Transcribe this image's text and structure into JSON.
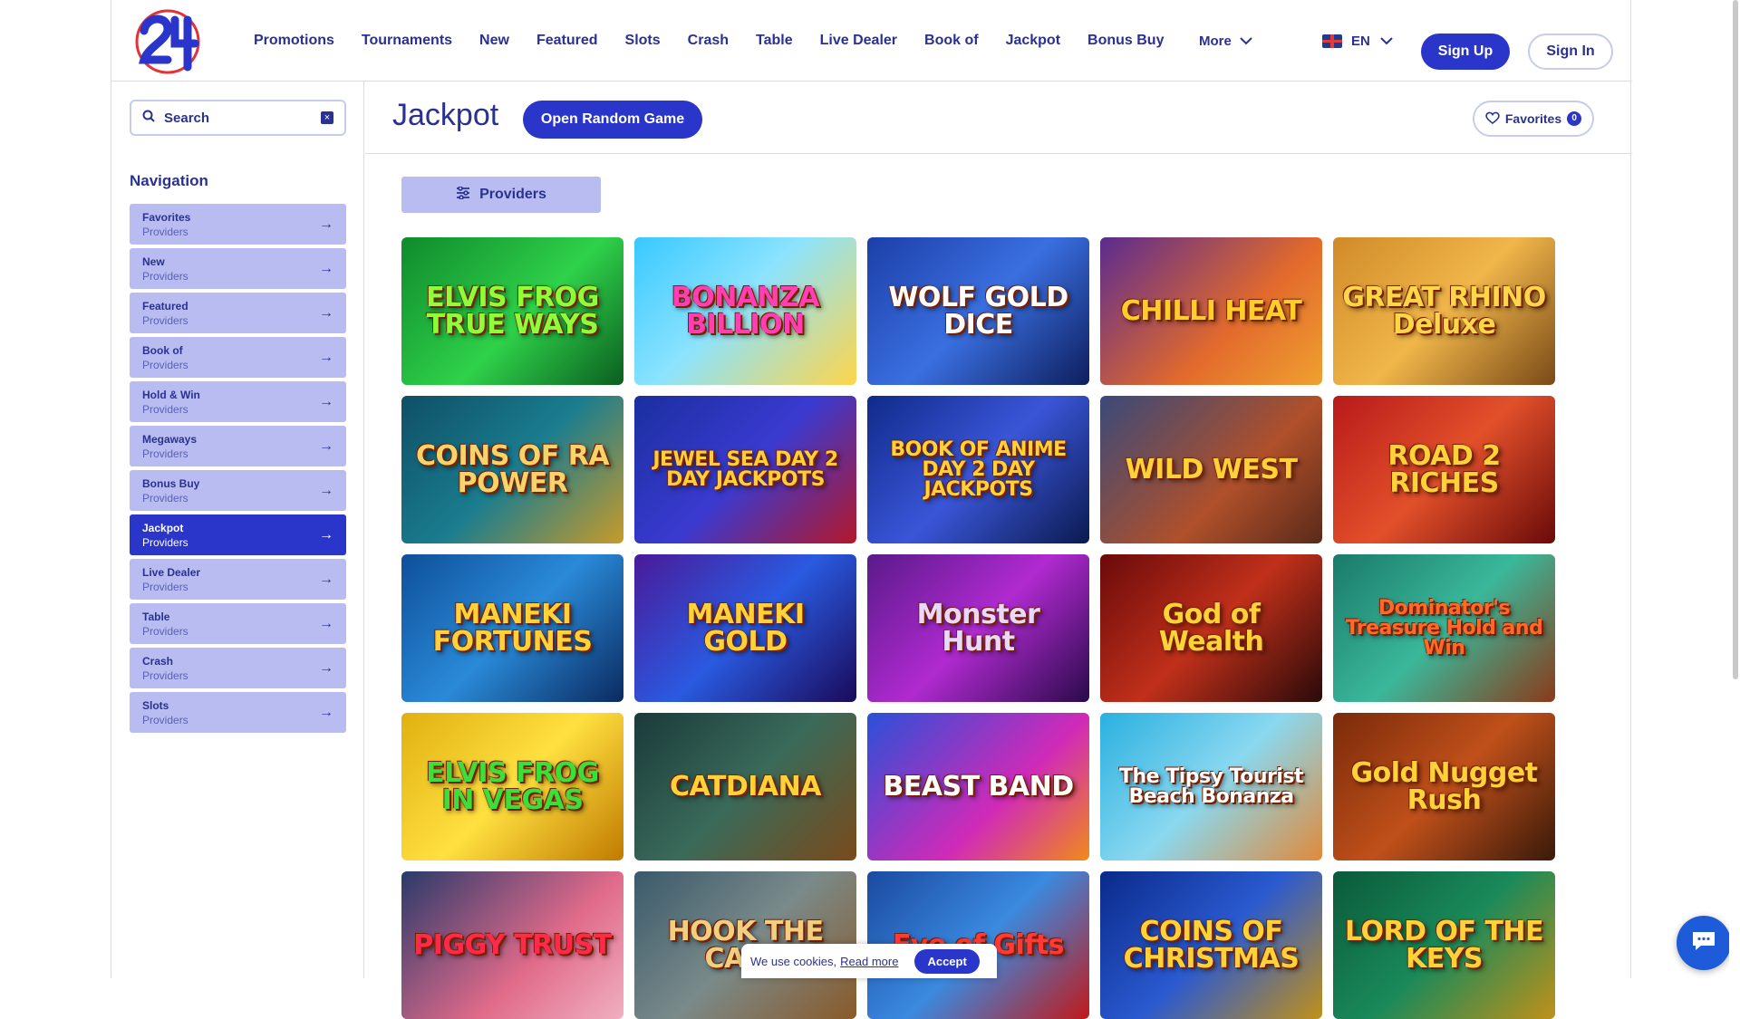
{
  "brand": {
    "logo_text": "24"
  },
  "nav": {
    "items": [
      "Promotions",
      "Tournaments",
      "New",
      "Featured",
      "Slots",
      "Crash",
      "Table",
      "Live Dealer",
      "Book of",
      "Jackpot",
      "Bonus Buy"
    ],
    "more_label": "More",
    "lang_label": "EN",
    "signup_label": "Sign Up",
    "signin_label": "Sign In"
  },
  "search": {
    "placeholder": "Search"
  },
  "sidebar": {
    "title": "Navigation",
    "items": [
      {
        "label": "Favorites",
        "sub": "Providers",
        "active": false
      },
      {
        "label": "New",
        "sub": "Providers",
        "active": false
      },
      {
        "label": "Featured",
        "sub": "Providers",
        "active": false
      },
      {
        "label": "Book of",
        "sub": "Providers",
        "active": false
      },
      {
        "label": "Hold & Win",
        "sub": "Providers",
        "active": false
      },
      {
        "label": "Megaways",
        "sub": "Providers",
        "active": false
      },
      {
        "label": "Bonus Buy",
        "sub": "Providers",
        "active": false
      },
      {
        "label": "Jackpot",
        "sub": "Providers",
        "active": true
      },
      {
        "label": "Live Dealer",
        "sub": "Providers",
        "active": false
      },
      {
        "label": "Table",
        "sub": "Providers",
        "active": false
      },
      {
        "label": "Crash",
        "sub": "Providers",
        "active": false
      },
      {
        "label": "Slots",
        "sub": "Providers",
        "active": false
      }
    ]
  },
  "main": {
    "title": "Jackpot",
    "random_label": "Open Random Game",
    "favorites_label": "Favorites",
    "favorites_count": "0",
    "providers_label": "Providers"
  },
  "games": [
    {
      "name": "ELVIS FROG TRUE WAYS",
      "bg": "linear-gradient(135deg,#0f8a2c,#2fd14a 55%,#0b5e20)",
      "color": "#8dff3a"
    },
    {
      "name": "BONANZA BILLION",
      "bg": "linear-gradient(135deg,#38c8ff,#8be3ff 45%,#ffd54a)",
      "color": "#ff3fb2"
    },
    {
      "name": "WOLF GOLD DICE",
      "bg": "linear-gradient(135deg,#1c3fa8,#3a6fe0 50%,#0e1f5e)",
      "color": "#ffffff"
    },
    {
      "name": "CHILLI HEAT",
      "bg": "linear-gradient(135deg,#5b2b8f,#e26a2c 60%,#f0a030)",
      "color": "#ffce2a"
    },
    {
      "name": "GREAT RHINO Deluxe",
      "bg": "linear-gradient(135deg,#d08a28,#f0b64a 50%,#7a4a18)",
      "color": "#ffd54a"
    },
    {
      "name": "COINS OF RA POWER",
      "bg": "linear-gradient(135deg,#0f4f66,#1a7d8f 50%,#c79a2a)",
      "color": "#f7d46a"
    },
    {
      "name": "JEWEL SEA DAY 2 DAY JACKPOTS",
      "bg": "linear-gradient(135deg,#1a2fa0,#3a3ad0 50%,#b3172a)",
      "color": "#ffcf3a"
    },
    {
      "name": "BOOK OF ANIME DAY 2 DAY JACKPOTS",
      "bg": "linear-gradient(135deg,#102a8a,#3a56d8 50%,#0b1a50)",
      "color": "#ffd23a"
    },
    {
      "name": "WILD WEST",
      "bg": "linear-gradient(135deg,#3a4a7a,#b0502a 60%,#5a2a1a)",
      "color": "#ffd23a"
    },
    {
      "name": "ROAD 2 RICHES",
      "bg": "linear-gradient(135deg,#b81a1a,#e2502a 50%,#6a0a0a)",
      "color": "#ffd23a"
    },
    {
      "name": "MANEKI FORTUNES",
      "bg": "linear-gradient(135deg,#0e4f9a,#2a8ad8 50%,#0a2a60)",
      "color": "#ffd23a"
    },
    {
      "name": "MANEKI GOLD",
      "bg": "linear-gradient(135deg,#4a1a9a,#2a5ae0 50%,#1a0a5a)",
      "color": "#ffd23a"
    },
    {
      "name": "Monster Hunt",
      "bg": "linear-gradient(135deg,#5a1a8a,#b02ad0 50%,#2a0a4a)",
      "color": "#e8d8ff"
    },
    {
      "name": "God of Wealth",
      "bg": "linear-gradient(135deg,#6a0a0a,#c0301a 50%,#2a0a0a)",
      "color": "#ffd23a"
    },
    {
      "name": "Dominator's Treasure Hold and Win",
      "bg": "linear-gradient(135deg,#1a7a6a,#3ab89a 50%,#8a3a1a)",
      "color": "#ff6a2a"
    },
    {
      "name": "ELVIS FROG IN VEGAS",
      "bg": "linear-gradient(135deg,#e0b010,#ffe040 50%,#c07a00)",
      "color": "#3adf3a"
    },
    {
      "name": "CATDIANA",
      "bg": "linear-gradient(135deg,#1a3a3a,#3a6a5a 50%,#7a4a1a)",
      "color": "#ffd23a"
    },
    {
      "name": "BEAST BAND",
      "bg": "linear-gradient(135deg,#2a50d8,#d02ab8 60%,#f08a1a)",
      "color": "#ffffff"
    },
    {
      "name": "The Tipsy Tourist Beach Bonanza",
      "bg": "linear-gradient(135deg,#2ab0e0,#8ad8f0 50%,#e08a3a)",
      "color": "#ffffff"
    },
    {
      "name": "Gold Nugget Rush",
      "bg": "linear-gradient(135deg,#7a2a0a,#c0501a 50%,#3a1a0a)",
      "color": "#ffd23a"
    },
    {
      "name": "PIGGY TRUST",
      "bg": "linear-gradient(135deg,#2a3a6a,#e06a8a 60%,#f0b0c0)",
      "color": "#ff2a4a"
    },
    {
      "name": "HOOK THE CASH",
      "bg": "linear-gradient(135deg,#3a5a6a,#7a8a8a 50%,#8a5a2a)",
      "color": "#f0d080"
    },
    {
      "name": "Eve of Gifts",
      "bg": "linear-gradient(135deg,#1a4aa0,#3a8ae0 50%,#c01a1a)",
      "color": "#ff3a3a"
    },
    {
      "name": "COINS OF CHRISTMAS",
      "bg": "linear-gradient(135deg,#0a2a8a,#2a5ad0 50%,#c0901a)",
      "color": "#ffd23a"
    },
    {
      "name": "LORD OF THE KEYS",
      "bg": "linear-gradient(135deg,#0a5a3a,#1a8a5a 50%,#c0901a)",
      "color": "#ffd23a"
    }
  ],
  "cookie": {
    "text": "We use cookies,",
    "link": "Read more",
    "accept_label": "Accept"
  }
}
